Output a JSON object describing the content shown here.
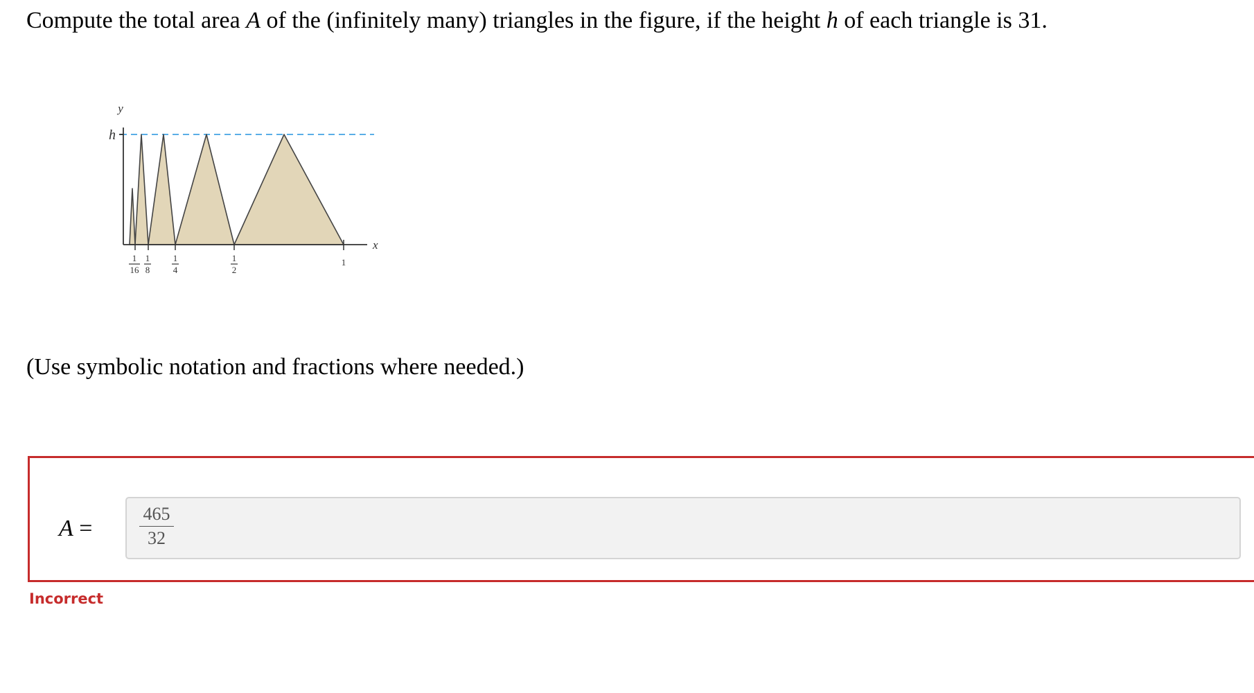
{
  "question": {
    "part1": "Compute the total area ",
    "var_a": "A",
    "part2": " of the (infinitely many) triangles in the figure, if the height ",
    "var_h": "h",
    "part3": " of each triangle is 31."
  },
  "figure": {
    "y_label": "y",
    "x_label": "x",
    "h_label": "h",
    "tick_labels": {
      "t16_num": "1",
      "t16_den": "16",
      "t8_num": "1",
      "t8_den": "8",
      "t4_num": "1",
      "t4_den": "4",
      "t2_num": "1",
      "t2_den": "2",
      "t1": "1"
    },
    "triangle_color": "#e2d6b8",
    "dash_color": "#5aaee6"
  },
  "note": "(Use symbolic notation and fractions where needed.)",
  "answer": {
    "variable": "A",
    "equals": "=",
    "numerator": "465",
    "denominator": "32"
  },
  "status": {
    "text": "Incorrect",
    "color": "#c62c2c"
  }
}
